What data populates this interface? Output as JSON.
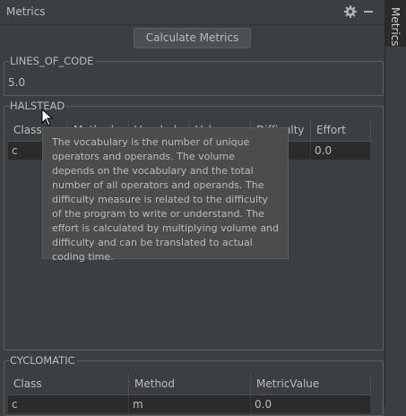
{
  "window": {
    "title": "Metrics",
    "side_tab": "Metrics"
  },
  "toolbar": {
    "calculate_label": "Calculate Metrics"
  },
  "lines_of_code": {
    "label": "LINES_OF_CODE",
    "value": "5.0"
  },
  "halstead": {
    "label": "HALSTEAD",
    "columns": [
      "Class",
      "Method",
      "Vocabulary",
      "Volume",
      "Difficulty",
      "Effort"
    ],
    "rows": [
      {
        "class": "c",
        "effort": "0.0"
      }
    ],
    "tooltip": "The vocabulary is the number of unique operators and operands. The volume depends on the vocabulary and the total number of all operators and operands. The difficulty measure is related to the difficulty of the program to write or understand. The effort is calculated by multiplying volume and difficulty and can be translated to actual coding time."
  },
  "cyclomatic": {
    "label": "CYCLOMATIC",
    "columns": [
      "Class",
      "Method",
      "MetricValue"
    ],
    "rows": [
      {
        "class": "c",
        "method": "m",
        "value": "0.0"
      }
    ]
  },
  "icons": {
    "settings": "gear-icon",
    "hide": "minimize-icon",
    "pointer": "mouse-pointer-icon"
  }
}
